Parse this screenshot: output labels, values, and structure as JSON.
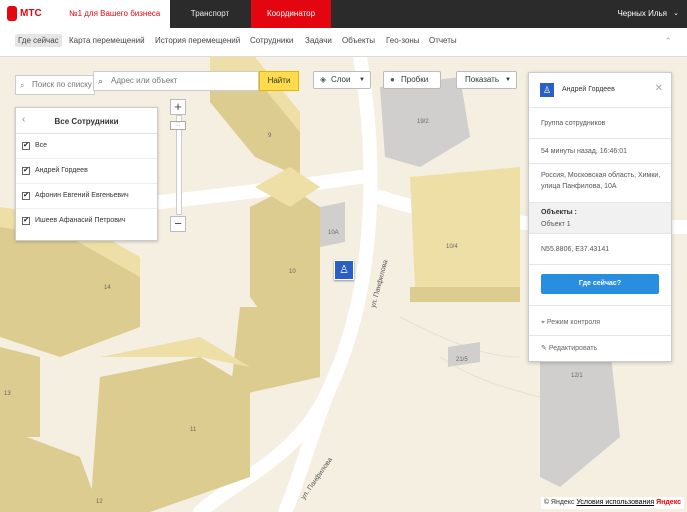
{
  "brand": {
    "logo_text": "МТС",
    "slogan": "№1 для Вашего бизнеса"
  },
  "top_tabs": [
    {
      "label": "Транспорт"
    },
    {
      "label": "Координатор"
    }
  ],
  "user": {
    "name": "Черных Илья"
  },
  "nav": {
    "items": [
      {
        "label": "Где сейчас"
      },
      {
        "label": "Карта перемещений"
      },
      {
        "label": "История перемещений"
      },
      {
        "label": "Сотрудники"
      },
      {
        "label": "Задачи"
      },
      {
        "label": "Объекты"
      },
      {
        "label": "Гео-зоны"
      },
      {
        "label": "Отчеты"
      }
    ],
    "collapse_icon": "chevron-up-icon"
  },
  "search": {
    "placeholder": "Поиск по списку"
  },
  "address_search": {
    "placeholder": "Адрес или объект",
    "button": "Найти"
  },
  "map_controls": {
    "layers": "Слои",
    "traffic": "Пробки",
    "show": "Показать"
  },
  "employees": {
    "title": "Все Сотрудники",
    "rows": [
      {
        "name": "Все",
        "checked": true
      },
      {
        "name": "Андрей Гордеев",
        "checked": true
      },
      {
        "name": "Афонин Евгений Евгеньевич",
        "checked": true
      },
      {
        "name": "Ишеев Афанасий Петрович",
        "checked": true
      }
    ]
  },
  "map": {
    "building_labels": [
      "9",
      "10А",
      "10",
      "14",
      "11",
      "12",
      "13",
      "19/2",
      "10/4",
      "21/5",
      "12/1"
    ],
    "streets": [
      "ул. Панфилова",
      "ул. Панфилова"
    ]
  },
  "info_card": {
    "name": "Андрей Гордеев",
    "group": "Группа сотрудников",
    "time": "54 минуты назад, 16:46:01",
    "address": "Россия, Московская область, Химки, улица Панфилова, 10А",
    "objects_label": "Объекты :",
    "objects_value": "Объект 1",
    "coords": "N55.8806, E37.43141",
    "where_button": "Где сейчас?",
    "control_mode": "Режим контроля",
    "edit": "Редактировать"
  },
  "copyright": {
    "text": "© Яндекс",
    "terms": "Условия использования",
    "brand": "Яндекс"
  },
  "colors": {
    "brand_red": "#e30611",
    "topbar": "#2b2b2b",
    "accent_blue": "#2a8ee0",
    "marker_blue": "#2a5fc4",
    "search_yellow": "#ffdb4d",
    "map_ground": "#f4efe1",
    "building_top": "#eedfa7"
  }
}
